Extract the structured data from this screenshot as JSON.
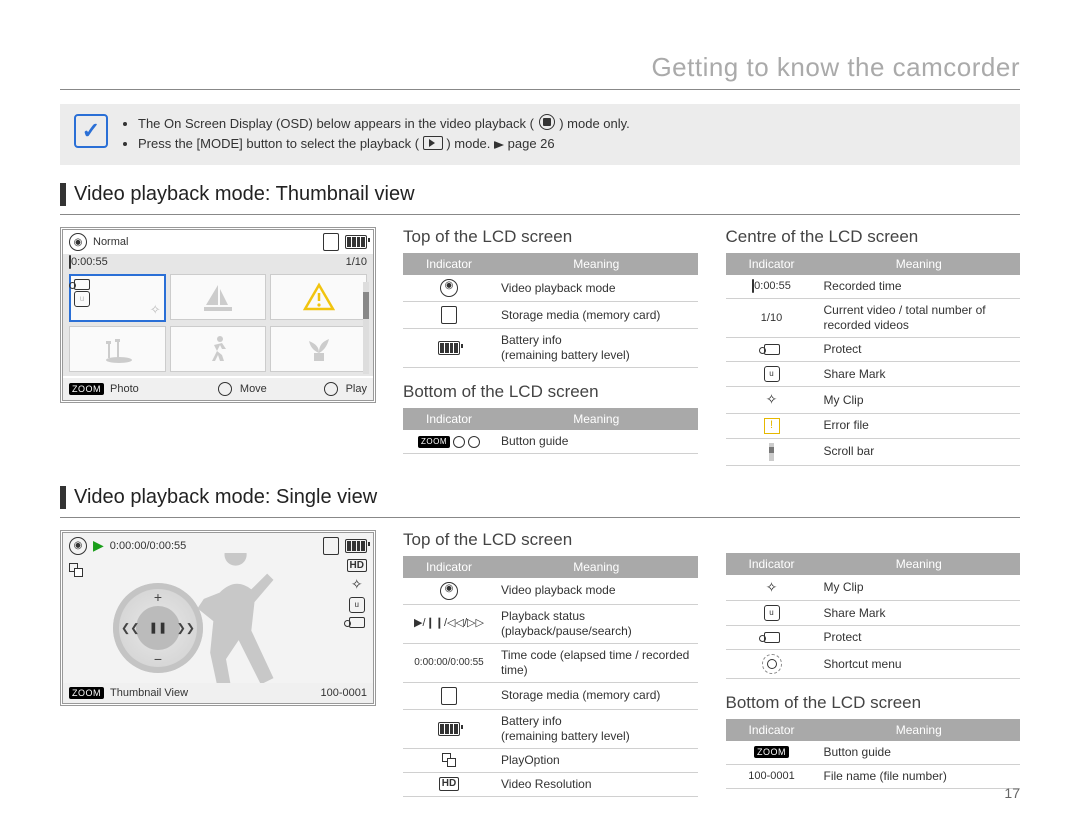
{
  "chapter_title": "Getting to know the camcorder",
  "note": {
    "line1_a": "The On Screen Display (OSD) below appears in the video playback (",
    "line1_b": ") mode only.",
    "line2_a": "Press the [MODE] button to select the playback (",
    "line2_b": ") mode. ",
    "page_ref": "page 26"
  },
  "section_thumb_heading": "Video playback mode: Thumbnail view",
  "section_single_heading": "Video playback mode: Single view",
  "table_headers": {
    "indicator": "Indicator",
    "meaning": "Meaning"
  },
  "lcd_thumb": {
    "mode_label": "Normal",
    "rec_time": "0:00:55",
    "index": "1/10",
    "bottom_photo": "Photo",
    "bottom_move": "Move",
    "bottom_play": "Play",
    "zoom_label": "ZOOM"
  },
  "lcd_single": {
    "timecode": "0:00:00/0:00:55",
    "bottom_thumb": "Thumbnail View",
    "file_no": "100-0001",
    "zoom_label": "ZOOM"
  },
  "thumb_top": {
    "heading": "Top of the LCD screen",
    "rows": [
      {
        "ind_html": "play-circle",
        "meaning": "Video playback mode"
      },
      {
        "ind_html": "card",
        "meaning": "Storage media (memory card)"
      },
      {
        "ind_html": "battery",
        "meaning": "Battery info\n(remaining battery level)"
      }
    ]
  },
  "thumb_bottom": {
    "heading": "Bottom of the LCD screen",
    "rows": [
      {
        "ind_html": "zoom-dots",
        "meaning": "Button guide"
      }
    ]
  },
  "thumb_centre": {
    "heading": "Centre of the LCD screen",
    "rows": [
      {
        "ind_text": "0:00:55",
        "ind_pre": "card-small",
        "meaning": "Recorded time"
      },
      {
        "ind_text": "1/10",
        "meaning": "Current video / total number of recorded videos"
      },
      {
        "ind_html": "key",
        "meaning": "Protect"
      },
      {
        "ind_html": "share",
        "meaning": "Share Mark"
      },
      {
        "ind_html": "clip",
        "meaning": "My Clip"
      },
      {
        "ind_html": "warn",
        "meaning": "Error file"
      },
      {
        "ind_html": "scroll",
        "meaning": "Scroll bar"
      }
    ]
  },
  "single_top_left": {
    "heading": "Top of the LCD screen",
    "rows": [
      {
        "ind_html": "play-circle",
        "meaning": "Video playback mode"
      },
      {
        "ind_text": "▶/❙❙/◁◁/▷▷",
        "glyph": true,
        "meaning": "Playback status (playback/pause/search)"
      },
      {
        "ind_text": "0:00:00/0:00:55",
        "meaning": "Time code (elapsed time / recorded time)"
      },
      {
        "ind_html": "card",
        "meaning": "Storage media (memory card)"
      },
      {
        "ind_html": "battery",
        "meaning": "Battery info\n(remaining battery level)"
      },
      {
        "ind_html": "playopt",
        "meaning": "PlayOption"
      },
      {
        "ind_html": "hd",
        "meaning": "Video Resolution"
      }
    ]
  },
  "single_top_right": {
    "rows": [
      {
        "ind_html": "clip",
        "meaning": "My Clip"
      },
      {
        "ind_html": "share",
        "meaning": "Share Mark"
      },
      {
        "ind_html": "key",
        "meaning": "Protect"
      },
      {
        "ind_html": "shortcut",
        "meaning": "Shortcut menu"
      }
    ]
  },
  "single_bottom": {
    "heading": "Bottom of the LCD screen",
    "rows": [
      {
        "ind_html": "zoom-only",
        "meaning": "Button guide"
      },
      {
        "ind_text": "100-0001",
        "meaning": "File name (file number)"
      }
    ]
  },
  "page_number": "17"
}
